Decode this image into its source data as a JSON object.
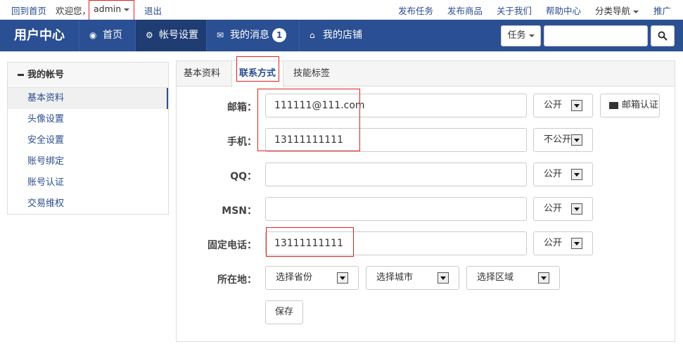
{
  "topbar": {
    "home_link": "回到首页",
    "welcome": "欢迎您，",
    "username": "admin",
    "logout": "退出",
    "links": [
      "发布任务",
      "发布商品",
      "关于我们",
      "帮助中心",
      "分类导航",
      "推广"
    ]
  },
  "header": {
    "brand": "用户中心",
    "nav": [
      {
        "label": "首页",
        "icon": "dashboard-icon",
        "glyph": "◉"
      },
      {
        "label": "帐号设置",
        "icon": "cogs-icon",
        "glyph": "⚙"
      },
      {
        "label": "我的消息",
        "icon": "envelope-icon",
        "glyph": "✉",
        "badge": "1"
      },
      {
        "label": "我的店铺",
        "icon": "home-icon",
        "glyph": "⌂"
      }
    ],
    "task_dropdown": "任务",
    "search_placeholder": ""
  },
  "sidebar": {
    "heading": "我的帐号",
    "items": [
      "基本资料",
      "头像设置",
      "安全设置",
      "账号绑定",
      "账号认证",
      "交易维权"
    ]
  },
  "tabs": [
    "基本资料",
    "联系方式",
    "技能标签"
  ],
  "form": {
    "email": {
      "label": "邮箱：",
      "value": "111111@111.com",
      "privacy": "公开",
      "verify": "邮箱认证"
    },
    "phone": {
      "label": "手机：",
      "value": "13111111111",
      "privacy": "不公开"
    },
    "qq": {
      "label": "QQ：",
      "value": "",
      "privacy": "公开"
    },
    "msn": {
      "label": "MSN：",
      "value": "",
      "privacy": "公开"
    },
    "tel": {
      "label": "固定电话：",
      "value": "13111111111",
      "privacy": "公开"
    },
    "location": {
      "label": "所在地：",
      "province": "选择省份",
      "city": "选择城市",
      "area": "选择区域"
    },
    "save": "保存"
  },
  "colors": {
    "header_bg": "#2b4f93",
    "highlight": "#e02020"
  }
}
